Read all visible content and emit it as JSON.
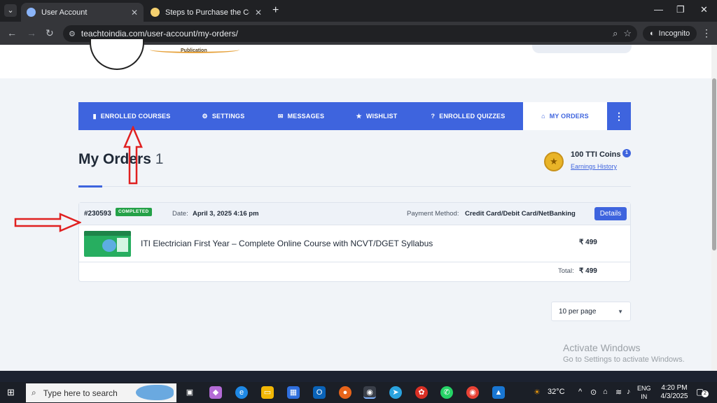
{
  "browser": {
    "tabs": [
      {
        "label": "User Account",
        "favicon_color": "#8ab4f8",
        "active": true
      },
      {
        "label": "Steps to Purchase the Course -",
        "favicon_color": "#f4d06f",
        "active": false
      }
    ],
    "url": "teachtoindia.com/user-account/my-orders/",
    "incognito_label": "Incognito",
    "icons": {
      "tab_menu": "chevron-down-icon",
      "close": "close-icon",
      "new_tab": "plus-icon",
      "back": "back-arrow-icon",
      "forward": "forward-arrow-icon",
      "reload": "reload-icon",
      "site_info": "site-settings-icon",
      "zoom": "zoom-icon",
      "bookmark": "star-icon",
      "incognito": "incognito-icon",
      "menu": "kebab-menu-icon",
      "minimize": "minimize-icon",
      "restore": "restore-icon",
      "close_window": "close-window-icon"
    }
  },
  "site_header": {
    "publication_label": "Publication"
  },
  "dashboard_nav": {
    "items": [
      {
        "label": "ENROLLED COURSES",
        "icon": "book-icon"
      },
      {
        "label": "SETTINGS",
        "icon": "gear-icon"
      },
      {
        "label": "MESSAGES",
        "icon": "envelope-icon"
      },
      {
        "label": "WISHLIST",
        "icon": "star-icon"
      },
      {
        "label": "ENROLLED QUIZZES",
        "icon": "question-icon"
      },
      {
        "label": "MY ORDERS",
        "icon": "basket-icon",
        "active": true
      }
    ],
    "more_icon": "vertical-dots-icon"
  },
  "page": {
    "title": "My Orders",
    "count": "1"
  },
  "coins": {
    "label": "100 TTI Coins",
    "history_link": "Earnings History",
    "badge": "1",
    "icon": "coin-icon"
  },
  "order": {
    "id": "#230593",
    "status": "COMPLETED",
    "date_label": "Date:",
    "date_value": "April 3, 2025 4:16 pm",
    "payment_label": "Payment Method:",
    "payment_value": "Credit Card/Debit Card/NetBanking",
    "details_label": "Details",
    "item_title": "ITI Electrician First Year – Complete Online Course with NCVT/DGET Syllabus",
    "item_price": "₹ 499",
    "total_label": "Total:",
    "total_value": "₹ 499"
  },
  "pagination": {
    "per_page": "10 per page"
  },
  "watermark": {
    "line1": "Activate Windows",
    "line2": "Go to Settings to activate Windows."
  },
  "annotation_color": "#e02020",
  "taskbar": {
    "search_placeholder": "Type here to search",
    "temperature": "32°C",
    "lang_line1": "ENG",
    "lang_line2": "IN",
    "time": "4:20 PM",
    "date": "4/3/2025",
    "notification_count": "2"
  },
  "colors": {
    "accent": "#3e64de",
    "status_green": "#24a148"
  }
}
